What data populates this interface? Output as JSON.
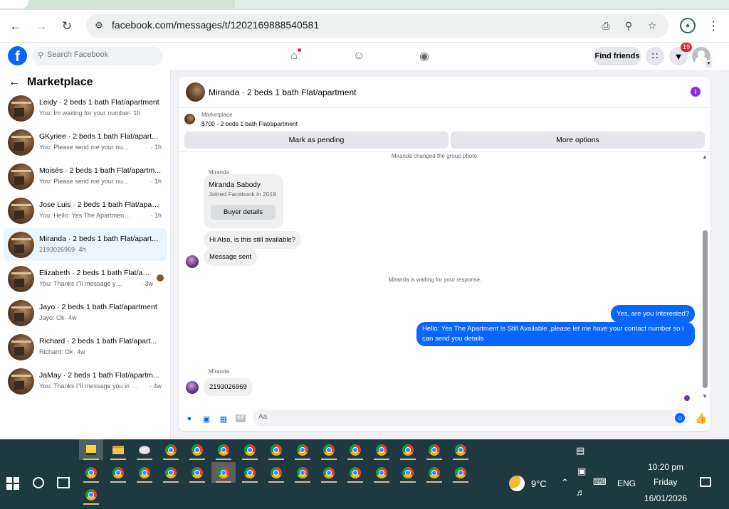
{
  "browser": {
    "url": "facebook.com/messages/t/1202169888540581"
  },
  "fb_header": {
    "search_placeholder": "Search Facebook",
    "find_friends": "Find friends",
    "notification_count": "19"
  },
  "sidebar": {
    "title": "Marketplace",
    "conversations": [
      {
        "name": "Leidy · 2 beds 1 bath Flat/apartment",
        "preview": "You: Im waiting for your number",
        "time": "· 1h",
        "active": false
      },
      {
        "name": "GKyriee · 2 beds 1 bath Flat/apart...",
        "preview": "You: Please send me your number so I...",
        "time": "· 1h",
        "active": false
      },
      {
        "name": "Moisés · 2 beds 1 bath Flat/apartm...",
        "preview": "You: Please send me your number so I...",
        "time": "· 1h",
        "active": false
      },
      {
        "name": "Jose Luis · 2 beds 1 bath Flat/apart...",
        "preview": "You: Hello: Yes The Apartment Is Still ...",
        "time": "· 1h",
        "active": false
      },
      {
        "name": "Miranda · 2 beds 1 bath Flat/apart...",
        "preview": "2193026969",
        "time": "· 4h",
        "active": true
      },
      {
        "name": "Elizabeth · 2 beds 1 bath Flat/ap...",
        "preview": "You: Thanks i''ll message you in a ...",
        "time": "· 3w",
        "active": false
      },
      {
        "name": "Jayo · 2 beds 1 bath Flat/apartment",
        "preview": "Jayo: Ok",
        "time": "· 4w",
        "active": false
      },
      {
        "name": "Richard · 2 beds 1 bath Flat/apart...",
        "preview": "Richard: Ok",
        "time": "· 4w",
        "active": false
      },
      {
        "name": "JaMay · 2 beds 1 bath Flat/apartm...",
        "preview": "You: Thanks i''ll message you in a mo...",
        "time": "· 4w",
        "active": false
      }
    ]
  },
  "chat": {
    "title": "Miranda · 2 beds 1 bath Flat/apartment",
    "listing_label": "Marketplace",
    "listing_title": "$700 - 2 beds 1 bath Flat/apartment",
    "mark_pending": "Mark as pending",
    "more_options": "More options",
    "system_photo": "Miranda changed the group photo.",
    "sender_name": "Miranda",
    "buyer_name": "Miranda Sabody",
    "buyer_joined": "Joined Facebook in 2019",
    "buyer_details": "Buyer details",
    "msg_available": "Hi Also, is this still available?",
    "msg_sent": "Message sent",
    "system_waiting": "Miranda is waiting for your response.",
    "out_interested": "Yes, are you interested?",
    "out_long": "Hello: Yes The Apartment Is Still Available ,please let me have your contact number so i can send you details",
    "sender_name_2": "Miranda",
    "msg_number": "2193026969",
    "composer_placeholder": "Aa",
    "gif": "GIF"
  },
  "taskbar": {
    "weather": "9°C",
    "language": "ENG",
    "time": "10:20 pm",
    "day": "Friday",
    "date": "16/01/2026"
  }
}
